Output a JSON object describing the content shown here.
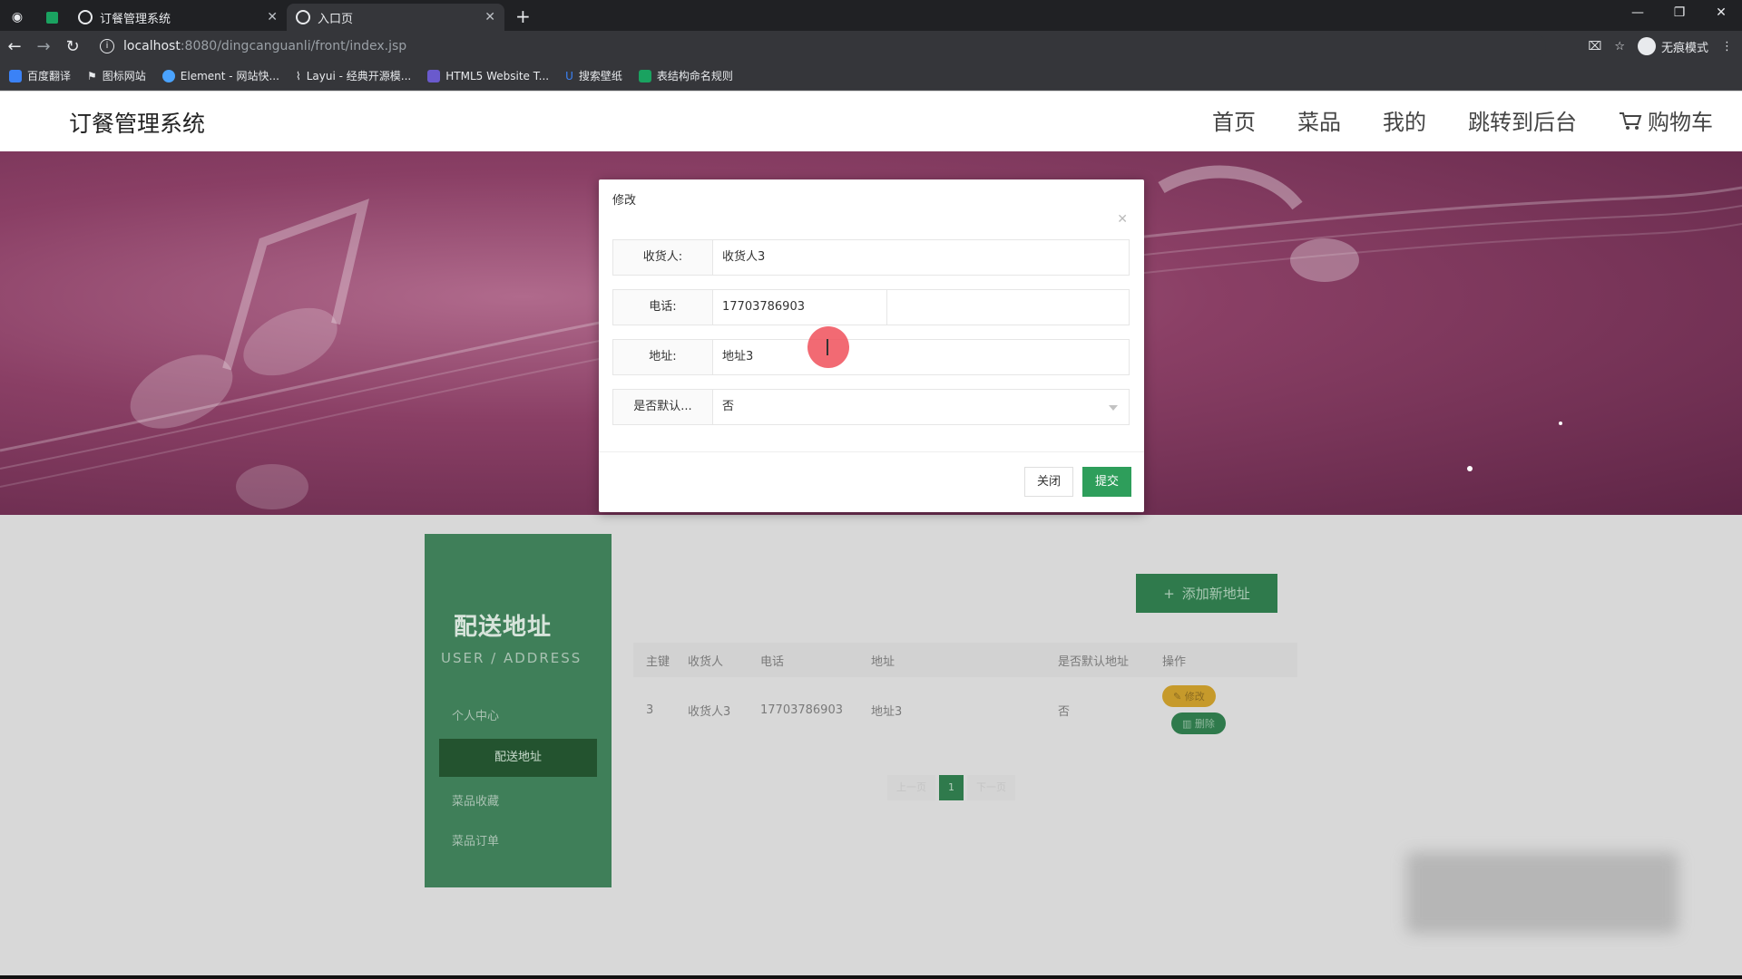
{
  "browser": {
    "tabs": [
      {
        "title": "订餐管理系统",
        "active": false
      },
      {
        "title": "入口页",
        "active": true
      }
    ],
    "url_host": "localhost",
    "url_path": ":8080/dingcanguanli/front/index.jsp",
    "profile_label": "无痕模式",
    "bookmarks": [
      {
        "label": "百度翻译",
        "color": "#3b82f6"
      },
      {
        "label": "图标网站",
        "color": "#e8eaed"
      },
      {
        "label": "Element - 网站快...",
        "color": "#4aa3ff"
      },
      {
        "label": "Layui - 经典开源模...",
        "color": "#e8eaed"
      },
      {
        "label": "HTML5 Website T...",
        "color": "#6a5acd"
      },
      {
        "label": "搜索壁纸",
        "color": "#3b82f6"
      },
      {
        "label": "表结构命名规则",
        "color": "#1aa260"
      }
    ]
  },
  "site": {
    "brand": "订餐管理系统",
    "nav": [
      "首页",
      "菜品",
      "我的",
      "跳转到后台",
      "购物车"
    ]
  },
  "sidebar": {
    "title": "配送地址",
    "subtitle": "USER / ADDRESS",
    "items": [
      "个人中心",
      "配送地址",
      "菜品收藏",
      "菜品订单"
    ],
    "active_index": 1
  },
  "main": {
    "add_button": "添加新地址",
    "table": {
      "headers": [
        "主键",
        "收货人",
        "电话",
        "地址",
        "是否默认地址",
        "操作"
      ],
      "rows": [
        {
          "id": "3",
          "receiver": "收货人3",
          "phone": "17703786903",
          "address": "地址3",
          "is_default": "否",
          "edit": "修改",
          "delete": "删除"
        }
      ]
    },
    "pagination": {
      "prev": "上一页",
      "current": "1",
      "next": "下一页"
    }
  },
  "modal": {
    "title": "修改",
    "fields": [
      {
        "label": "收货人:",
        "value": "收货人3"
      },
      {
        "label": "电话:",
        "value": "17703786903"
      },
      {
        "label": "地址:",
        "value": "地址3"
      },
      {
        "label": "是否默认...",
        "value": "否"
      }
    ],
    "close_label": "关闭",
    "submit_label": "提交"
  },
  "colors": {
    "accent_green": "#2e9e5b",
    "sidebar_green": "#3f7f59",
    "edit_yellow": "#c69a2b"
  }
}
